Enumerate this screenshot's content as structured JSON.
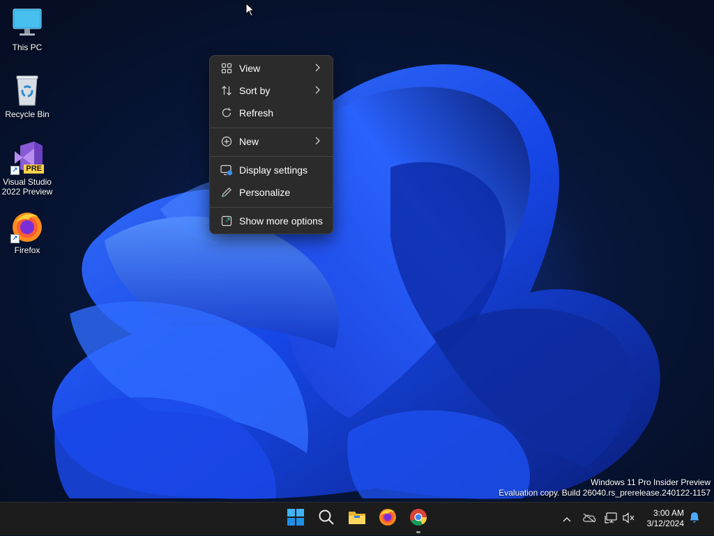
{
  "desktop": {
    "icons": [
      {
        "label": "This PC",
        "icon": "monitor-icon"
      },
      {
        "label": "Recycle Bin",
        "icon": "recycle-bin-icon"
      },
      {
        "label": "Visual Studio\n2022 Preview",
        "label_line1": "Visual Studio",
        "label_line2": "2022 Preview",
        "badge": "PRE",
        "icon": "visual-studio-icon"
      },
      {
        "label": "Firefox",
        "icon": "firefox-icon"
      }
    ]
  },
  "context_menu": {
    "items": [
      {
        "label": "View",
        "icon": "grid-icon",
        "submenu": true
      },
      {
        "label": "Sort by",
        "icon": "sort-icon",
        "submenu": true
      },
      {
        "label": "Refresh",
        "icon": "refresh-icon",
        "submenu": false
      },
      {
        "label": "New",
        "icon": "plus-circle-icon",
        "submenu": true
      },
      {
        "label": "Display settings",
        "icon": "display-settings-icon",
        "submenu": false
      },
      {
        "label": "Personalize",
        "icon": "pen-icon",
        "submenu": false
      },
      {
        "label": "Show more options",
        "icon": "open-external-icon",
        "submenu": false
      }
    ]
  },
  "watermark": {
    "line1": "Windows 11 Pro Insider Preview",
    "line2": "Evaluation copy. Build 26040.rs_prerelease.240122-1157"
  },
  "taskbar": {
    "apps": [
      "start-icon",
      "search-icon",
      "file-explorer-icon",
      "firefox-icon",
      "chrome-icon"
    ],
    "tray": [
      "chevron-up-icon",
      "onedrive-icon",
      "network-icon",
      "volume-muted-icon"
    ],
    "time": "3:00 AM",
    "date": "3/12/2024"
  },
  "colors": {
    "menu_bg": "#2b2b2b",
    "taskbar_bg": "#1c1c1c",
    "accent": "#0078d4",
    "wallpaper_blue": "#1f4fff"
  }
}
